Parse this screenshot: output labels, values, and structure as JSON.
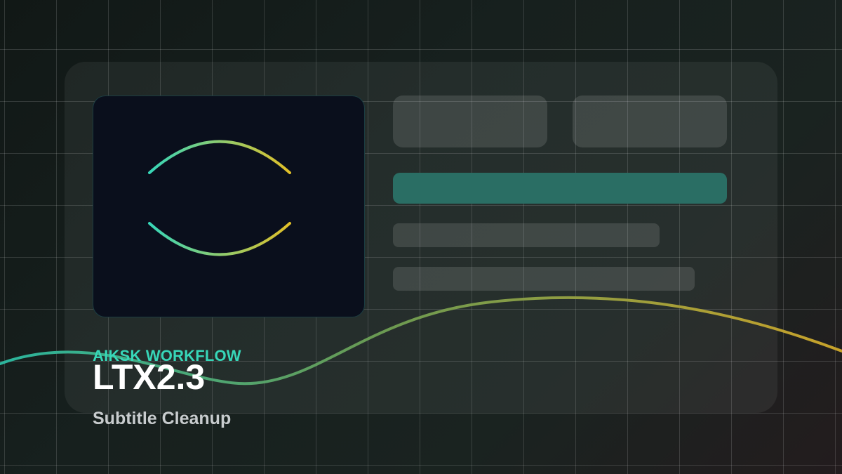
{
  "hero": {
    "brand": "AIKSK WORKFLOW",
    "title": "LTX2.3",
    "subtitle": "Subtitle Cleanup"
  },
  "icons": {
    "preview": "eye-icon"
  },
  "colors": {
    "accent_teal": "#37d6b8",
    "accent_yellow": "#e2c028",
    "accent_bar": "#2a6e64",
    "card_bg": "#0a0f1c"
  }
}
